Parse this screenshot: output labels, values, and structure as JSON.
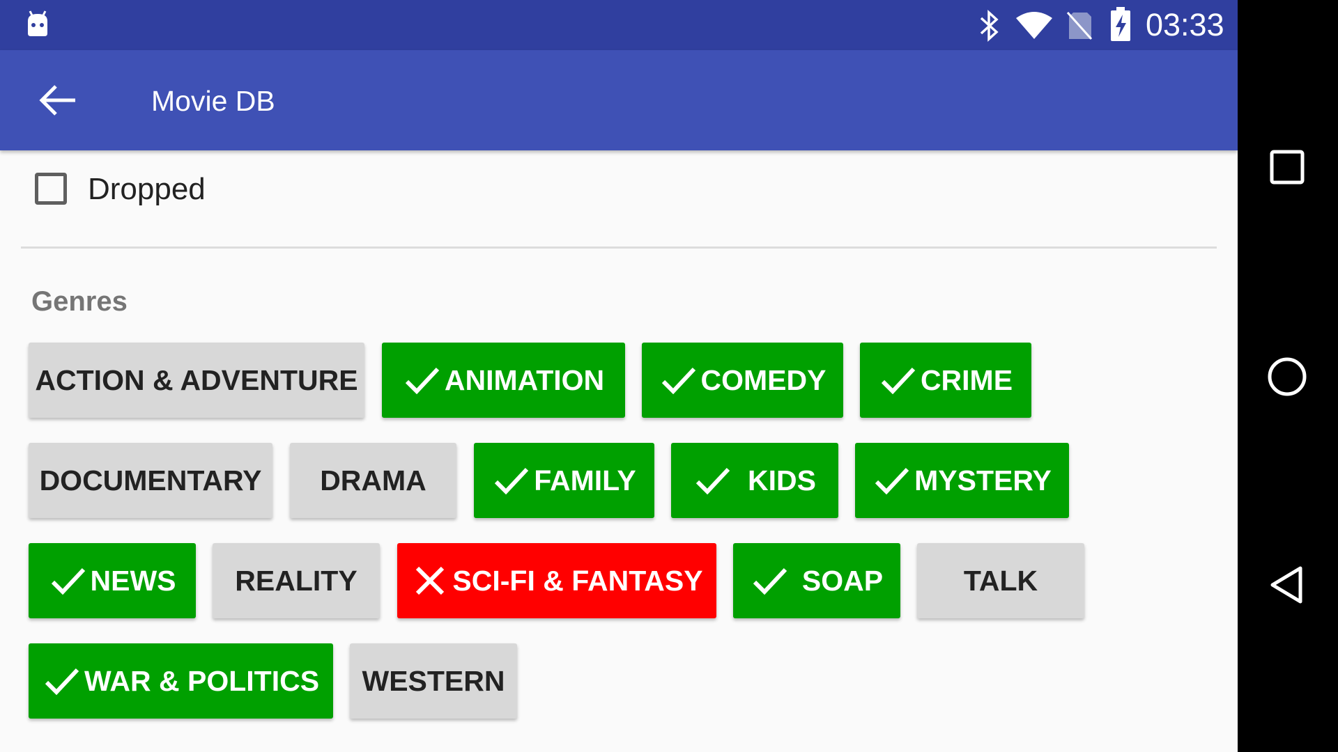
{
  "status_bar": {
    "time": "03:33",
    "icons": [
      "android-debug-icon",
      "bluetooth-icon",
      "wifi-icon",
      "no-sim-icon",
      "battery-charging-icon"
    ]
  },
  "app_bar": {
    "title": "Movie DB",
    "back_icon": "arrow-back-icon"
  },
  "dropped": {
    "label": "Dropped",
    "checked": false
  },
  "genres": {
    "title": "Genres",
    "chips": [
      {
        "label": "ACTION & ADVENTURE",
        "state": "neutral"
      },
      {
        "label": "ANIMATION",
        "state": "included"
      },
      {
        "label": "COMEDY",
        "state": "included"
      },
      {
        "label": "CRIME",
        "state": "included"
      },
      {
        "label": "DOCUMENTARY",
        "state": "neutral"
      },
      {
        "label": "DRAMA",
        "state": "neutral"
      },
      {
        "label": "FAMILY",
        "state": "included"
      },
      {
        "label": "KIDS",
        "state": "included"
      },
      {
        "label": "MYSTERY",
        "state": "included"
      },
      {
        "label": "NEWS",
        "state": "included"
      },
      {
        "label": "REALITY",
        "state": "neutral"
      },
      {
        "label": "SCI-FI & FANTASY",
        "state": "excluded"
      },
      {
        "label": "SOAP",
        "state": "included"
      },
      {
        "label": "TALK",
        "state": "neutral"
      },
      {
        "label": "WAR & POLITICS",
        "state": "included"
      },
      {
        "label": "WESTERN",
        "state": "neutral"
      }
    ]
  },
  "nav_bar": {
    "icons": [
      "recents-square-icon",
      "home-circle-icon",
      "back-triangle-icon"
    ]
  },
  "colors": {
    "status_bar": "#303f9f",
    "app_bar": "#3f51b5",
    "included": "#00a000",
    "excluded": "#ff0000",
    "neutral": "#d8d8d8"
  }
}
